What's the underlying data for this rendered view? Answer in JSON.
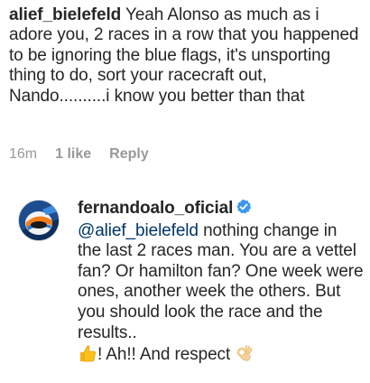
{
  "comment1": {
    "username": "alief_bielefeld",
    "text": "Yeah Alonso as much as i adore you, 2 races in a row that you happened to be ignoring the blue flags, it's unsporting thing to do, sort your racecraft out, Nando..........i know you better than that",
    "time": "16m",
    "likes": "1 like",
    "reply_label": "Reply"
  },
  "comment2": {
    "username": "fernandoalo_oficial",
    "mention": "@alief_bielefeld",
    "text": "nothing change in the last 2 races man. You are a vettel fan? Or hamilton fan? One week were ones, another week the others. But you should look the race and the results..",
    "ending": "! Ah!! And respect",
    "thumbs_icon": "thumbs-up-emoji",
    "ok_icon": "ok-hand-emoji",
    "verified_icon": "verified-badge-icon"
  },
  "colors": {
    "text": "#262626",
    "meta": "#999999",
    "mention": "#003569",
    "verified": "#3897f0"
  }
}
